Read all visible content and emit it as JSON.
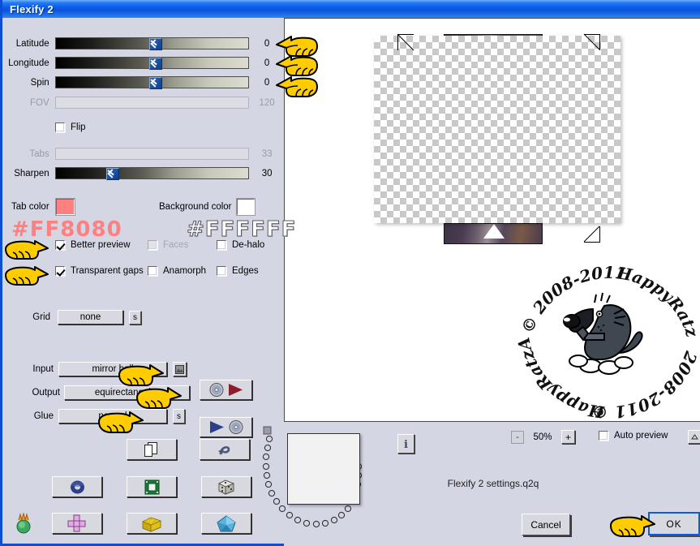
{
  "window": {
    "title": "Flexify 2"
  },
  "sliders": [
    {
      "label": "Latitude",
      "value": "0",
      "pos": 44,
      "disabled": false
    },
    {
      "label": "Longitude",
      "value": "0",
      "pos": 44,
      "disabled": false
    },
    {
      "label": "Spin",
      "value": "0",
      "pos": 44,
      "disabled": false
    },
    {
      "label": "FOV",
      "value": "120",
      "pos": 0,
      "disabled": true
    },
    {
      "label": "Tabs",
      "value": "33",
      "pos": 0,
      "disabled": true
    },
    {
      "label": "Sharpen",
      "value": "30",
      "pos": 23,
      "disabled": false
    }
  ],
  "flip": {
    "label": "Flip",
    "checked": false
  },
  "colors": {
    "tab_color_label": "Tab color",
    "tab_color_hex": "#FF8080",
    "tab_color_swatch": "#FF8080",
    "background_color_label": "Background color",
    "background_color_hex": "#FFFFFF",
    "background_color_swatch": "#FFFFFF"
  },
  "checkboxes": [
    {
      "label": "Better preview",
      "checked": true,
      "disabled": false
    },
    {
      "label": "Faces",
      "checked": false,
      "disabled": true
    },
    {
      "label": "De-halo",
      "checked": false,
      "disabled": false
    },
    {
      "label": "Transparent gaps",
      "checked": true,
      "disabled": false
    },
    {
      "label": "Anamorph",
      "checked": false,
      "disabled": false
    },
    {
      "label": "Edges",
      "checked": false,
      "disabled": false
    }
  ],
  "grid": {
    "label": "Grid",
    "value": "none",
    "side_button": "s"
  },
  "mapping": {
    "input": {
      "label": "Input",
      "value": "mirror ball",
      "side_button": "img"
    },
    "output": {
      "label": "Output",
      "value": "equirectangular",
      "side_button": ""
    },
    "glue": {
      "label": "Glue",
      "value": "normal",
      "side_button": "s"
    }
  },
  "icon_buttons": {
    "load_settings": "disc-to-arrow-icon",
    "save_settings": "arrow-to-disc-icon",
    "copy": "copy-pages-icon",
    "undo": "undo-arrow-icon",
    "sphere": "torus-icon",
    "square": "green-square-icon",
    "dice": "dice-icon",
    "cross": "cross-net-icon",
    "brick": "yellow-brick-icon",
    "gem": "blue-gem-icon",
    "bulb": "green-bulb-icon",
    "info": "info-icon",
    "collapse": "caret-up-icon"
  },
  "zoom": {
    "minus": "-",
    "level": "50%",
    "plus": "+"
  },
  "auto_preview": {
    "label": "Auto preview",
    "checked": false
  },
  "status": {
    "settings_file": "Flexify 2 settings.q2q"
  },
  "buttons": {
    "cancel": "Cancel",
    "ok": "OK"
  },
  "watermark": {
    "top_text": "HappyRatzAlan",
    "years": "© 2008-2011",
    "bottom_text": "HappyRatzAlan",
    "bottom_years": "2008-2011 ©"
  },
  "preview": {
    "image_strip_color": "#4a3d52"
  }
}
